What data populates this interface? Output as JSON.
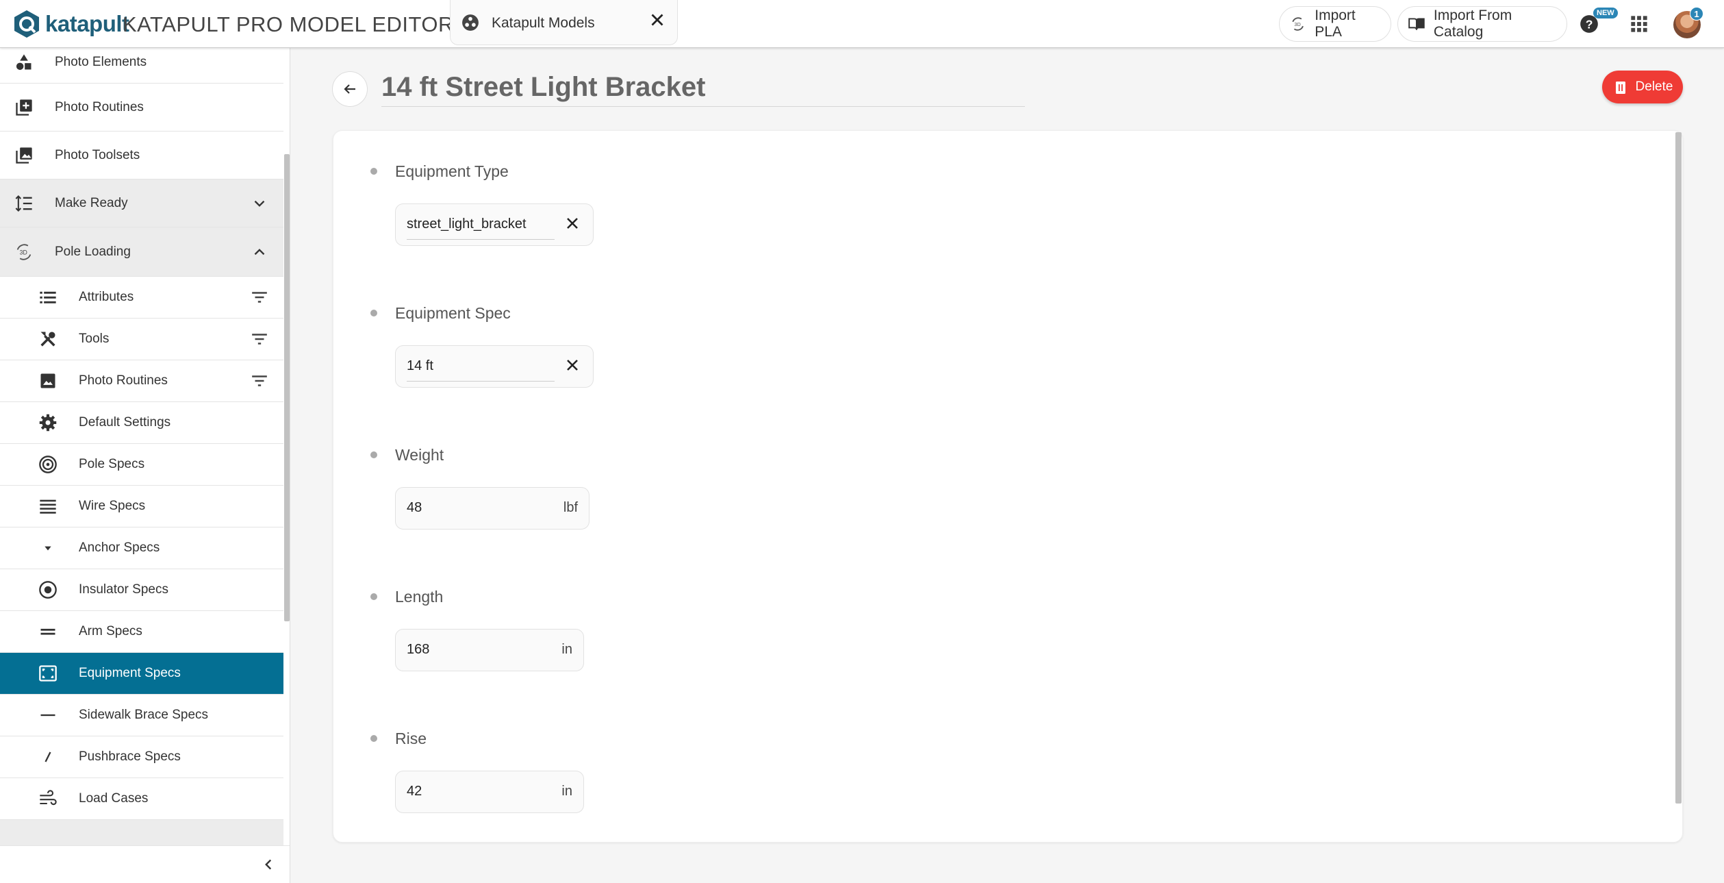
{
  "header": {
    "logo_text": "katapult",
    "app_title": "KATAPULT PRO MODEL EDITOR",
    "model_chip_label": "Katapult Models",
    "import_pla_label": "Import PLA",
    "import_catalog_label": "Import From Catalog",
    "new_badge": "NEW",
    "notification_count": "1"
  },
  "sidebar": {
    "items": [
      {
        "label": "Photo Elements",
        "icon": "shapes-icon"
      },
      {
        "label": "Photo Routines",
        "icon": "library-add-icon"
      },
      {
        "label": "Photo Toolsets",
        "icon": "photo-library-icon"
      },
      {
        "label": "Make Ready",
        "icon": "format-line-spacing-icon",
        "expanded": false
      },
      {
        "label": "Pole Loading",
        "icon": "3d-rotation-icon",
        "expanded": true
      }
    ],
    "sub_items": [
      {
        "label": "Attributes",
        "icon": "list-icon",
        "filter": true
      },
      {
        "label": "Tools",
        "icon": "tools-icon",
        "filter": true
      },
      {
        "label": "Photo Routines",
        "icon": "image-icon",
        "filter": true
      },
      {
        "label": "Default Settings",
        "icon": "gear-icon"
      },
      {
        "label": "Pole Specs",
        "icon": "pole-rings-icon"
      },
      {
        "label": "Wire Specs",
        "icon": "wire-lines-icon"
      },
      {
        "label": "Anchor Specs",
        "icon": "arrow-drop-down-icon"
      },
      {
        "label": "Insulator Specs",
        "icon": "radio-button-icon"
      },
      {
        "label": "Arm Specs",
        "icon": "equal-icon"
      },
      {
        "label": "Equipment Specs",
        "icon": "equipment-frame-icon",
        "active": true
      },
      {
        "label": "Sidewalk Brace Specs",
        "icon": "horizontal-dash-icon"
      },
      {
        "label": "Pushbrace Specs",
        "icon": "slash-icon"
      },
      {
        "label": "Load Cases",
        "icon": "wind-icon"
      }
    ]
  },
  "page": {
    "title": "14 ft Street Light Bracket",
    "delete_label": "Delete"
  },
  "fields": [
    {
      "label": "Equipment Type",
      "value": "street_light_bracket",
      "kind": "select"
    },
    {
      "label": "Equipment Spec",
      "value": "14 ft",
      "kind": "select"
    },
    {
      "label": "Weight",
      "value": "48",
      "unit": "lbf",
      "kind": "number"
    },
    {
      "label": "Length",
      "value": "168",
      "unit": "in",
      "kind": "number"
    },
    {
      "label": "Rise",
      "value": "42",
      "unit": "in",
      "kind": "number"
    }
  ],
  "colors": {
    "accent": "#046f93",
    "delete": "#ef3b35",
    "badge": "#2b86b6"
  }
}
